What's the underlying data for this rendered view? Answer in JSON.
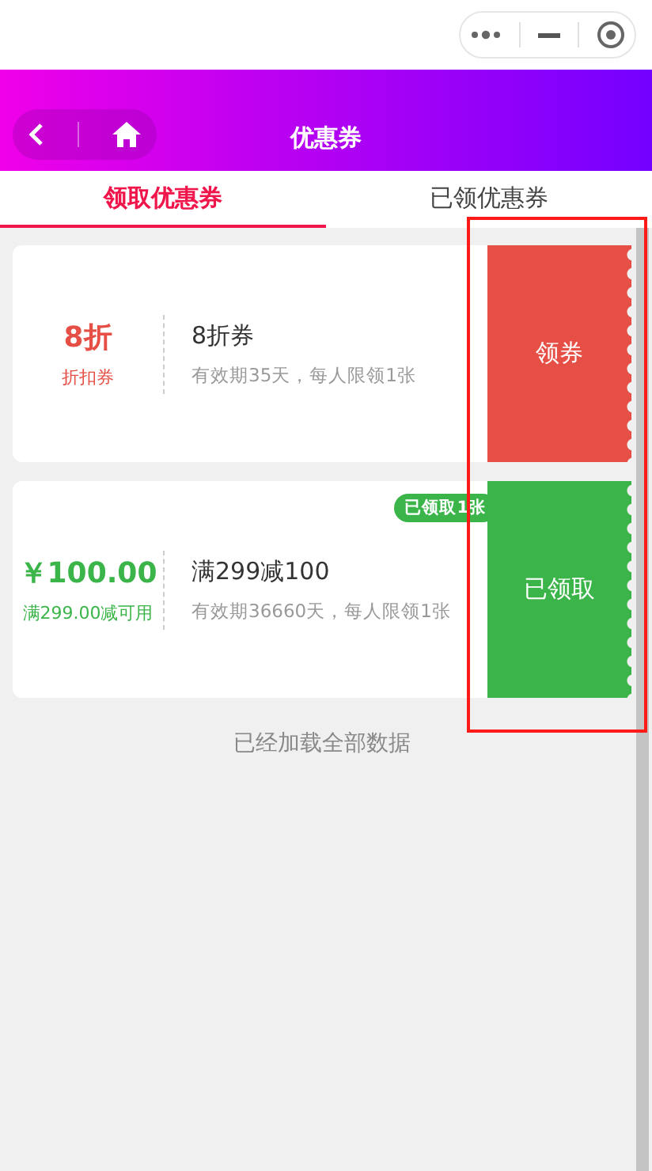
{
  "header": {
    "title": "优惠券"
  },
  "tabs": [
    {
      "label": "领取优惠券",
      "selected": true
    },
    {
      "label": "已领优惠券",
      "selected": false
    }
  ],
  "coupons": [
    {
      "value": "8折",
      "condition": "折扣券",
      "title": "8折券",
      "description": "有效期35天，每人限领1张",
      "action": "领券",
      "claimed": false
    },
    {
      "value": "￥100.00",
      "condition": "满299.00减可用",
      "title": "满299减100",
      "description": "有效期36660天，每人限领1张",
      "action": "已领取",
      "claimed": true,
      "badge": "已领取1张"
    }
  ],
  "footer": "已经加载全部数据",
  "highlight": {
    "shown": true
  }
}
